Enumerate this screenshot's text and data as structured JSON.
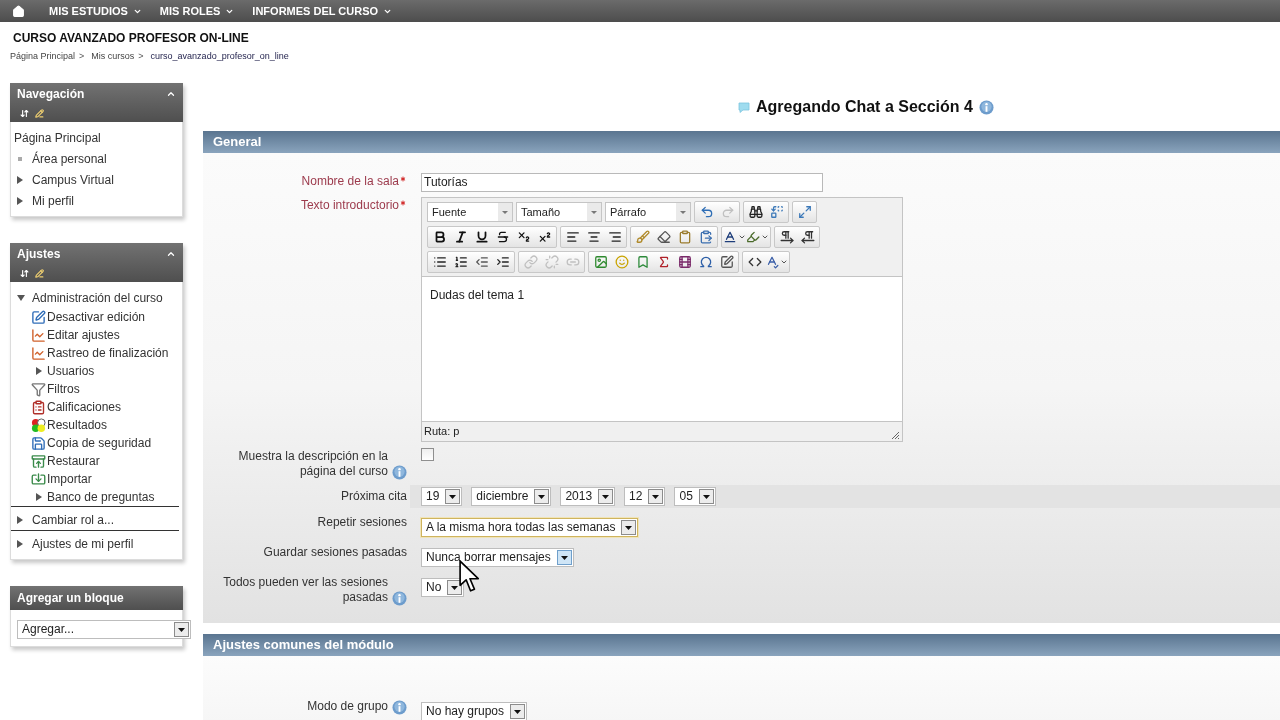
{
  "top_menu": [
    {
      "label": "MIS ESTUDIOS"
    },
    {
      "label": "MIS ROLES"
    },
    {
      "label": "INFORMES DEL CURSO"
    }
  ],
  "course_title": "CURSO AVANZADO PROFESOR ON-LINE",
  "breadcrumb": [
    {
      "label": "Página Principal",
      "separator": ">"
    },
    {
      "label": "Mis cursos",
      "separator": ">"
    },
    {
      "label": "curso_avanzado_profesor_on_line"
    }
  ],
  "blocks": [
    {
      "kind": "tree",
      "title": "Navegación",
      "divided": false,
      "items": [
        {
          "kind": "page",
          "label": "Página Principal"
        },
        {
          "kind": "bullet",
          "label": "Área personal"
        },
        {
          "kind": "branch",
          "label": "Campus Virtual",
          "expanded": false
        },
        {
          "kind": "branch",
          "label": "Mi perfil",
          "expanded": false
        }
      ]
    },
    {
      "kind": "tree",
      "title": "Ajustes",
      "divided": true,
      "items": [
        {
          "kind": "branch",
          "label": "Administración del curso",
          "expanded": true,
          "children": [
            {
              "kind": "action",
              "label": "Desactivar edición"
            },
            {
              "kind": "action",
              "label": "Editar ajustes"
            },
            {
              "kind": "action",
              "label": "Rastreo de finalización"
            },
            {
              "kind": "branch",
              "label": "Usuarios",
              "expanded": false
            },
            {
              "kind": "action",
              "label": "Filtros"
            },
            {
              "kind": "action",
              "label": "Calificaciones"
            },
            {
              "kind": "action",
              "label": "Resultados"
            },
            {
              "kind": "action",
              "label": "Copia de seguridad"
            },
            {
              "kind": "action",
              "label": "Restaurar"
            },
            {
              "kind": "action",
              "label": "Importar"
            },
            {
              "kind": "branch",
              "label": "Banco de preguntas",
              "expanded": false
            }
          ]
        },
        {
          "kind": "branch",
          "label": "Cambiar rol a...",
          "expanded": false
        },
        {
          "kind": "branch",
          "label": "Ajustes de mi perfil",
          "expanded": false
        }
      ]
    },
    {
      "kind": "add",
      "title": "Agregar un bloque",
      "select": {
        "value": "Agregar..."
      }
    }
  ],
  "page_heading": "Agregando Chat a Sección 4",
  "sections": [
    {
      "title": "General",
      "fields": [
        {
          "kind": "text",
          "label": "Nombre de la sala",
          "required": true,
          "help": false,
          "value": "Tutorías"
        },
        {
          "kind": "editor",
          "label": "Texto introductorio",
          "required": true,
          "help": false,
          "toolbar": [
            {
              "dropdowns": [
                {
                  "value": "Fuente"
                },
                {
                  "value": "Tamaño"
                },
                {
                  "value": "Párrafo"
                }
              ],
              "groups": [
                [
                  {
                    "disabled": false
                  },
                  {
                    "disabled": true
                  }
                ],
                [
                  {
                    "disabled": false
                  },
                  {
                    "disabled": false
                  }
                ],
                [
                  {
                    "disabled": false
                  }
                ]
              ]
            },
            {
              "groups": [
                [
                  {
                    "disabled": false
                  },
                  {
                    "disabled": false
                  },
                  {
                    "disabled": false
                  },
                  {
                    "disabled": false
                  },
                  {
                    "disabled": false
                  },
                  {
                    "disabled": false
                  }
                ],
                [
                  {
                    "disabled": false
                  },
                  {
                    "disabled": false
                  },
                  {
                    "disabled": false
                  }
                ],
                [
                  {
                    "disabled": false
                  },
                  {
                    "disabled": false
                  },
                  {
                    "disabled": false
                  },
                  {
                    "disabled": false
                  }
                ],
                [
                  {
                    "disabled": false
                  },
                  {
                    "disabled": false
                  }
                ],
                [
                  {
                    "disabled": false
                  },
                  {
                    "disabled": false
                  }
                ]
              ]
            },
            {
              "groups": [
                [
                  {
                    "disabled": false
                  },
                  {
                    "disabled": false
                  },
                  {
                    "disabled": false
                  },
                  {
                    "disabled": false
                  }
                ],
                [
                  {
                    "disabled": true
                  },
                  {
                    "disabled": true
                  },
                  {
                    "disabled": true
                  }
                ],
                [
                  {
                    "disabled": false
                  },
                  {
                    "disabled": false
                  },
                  {
                    "disabled": false
                  },
                  {
                    "disabled": false
                  },
                  {
                    "disabled": false
                  },
                  {
                    "disabled": false
                  },
                  {
                    "disabled": false
                  }
                ],
                [
                  {
                    "disabled": false
                  },
                  {
                    "disabled": false
                  }
                ]
              ]
            }
          ],
          "content": "Dudas del tema 1",
          "path": "Ruta: p"
        },
        {
          "kind": "checkbox",
          "label": "Muestra la descripción en la página del curso",
          "required": false,
          "help": true,
          "checked": false
        },
        {
          "kind": "date",
          "label": "Próxima cita",
          "required": false,
          "help": false,
          "selects": [
            {
              "value": "19"
            },
            {
              "value": "diciembre"
            },
            {
              "value": "2013"
            },
            {
              "value": "12"
            },
            {
              "value": "05"
            }
          ]
        },
        {
          "kind": "select",
          "label": "Repetir sesiones",
          "required": false,
          "help": false,
          "value": "A la misma hora todas las semanas",
          "focused": true,
          "hovered": false
        },
        {
          "kind": "select",
          "label": "Guardar sesiones pasadas",
          "required": false,
          "help": false,
          "value": "Nunca borrar mensajes",
          "focused": false,
          "hovered": true
        },
        {
          "kind": "select",
          "label": "Todos pueden ver las sesiones pasadas",
          "required": false,
          "help": true,
          "value": "No",
          "focused": false,
          "hovered": false
        }
      ]
    },
    {
      "title": "Ajustes comunes del módulo",
      "fields": [
        {
          "kind": "select",
          "label": "Modo de grupo",
          "required": false,
          "help": true,
          "value": "No hay grupos",
          "focused": false,
          "hovered": false
        }
      ]
    }
  ]
}
